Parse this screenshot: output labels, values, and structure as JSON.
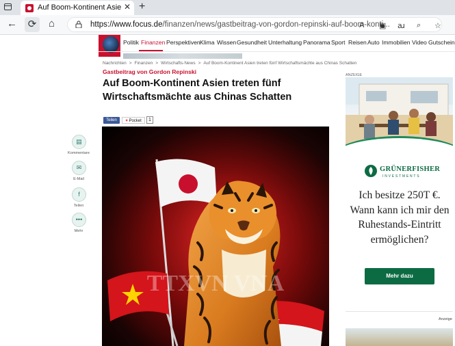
{
  "browser": {
    "tab_title": "Auf Boom-Kontinent Asien treten",
    "tab_close": "✕",
    "new_tab": "+",
    "url_domain": "https://www.focus.de",
    "url_path": "/finanzen/news/gastbeitrag-von-gordon-repinski-auf-boom-konti...",
    "icons": {
      "back": "←",
      "reload": "⟳",
      "home": "⌂",
      "lock": "🔒",
      "read_aloud": "A",
      "immersive": "▣",
      "translate": "ꜷ",
      "zoom": "⌕",
      "favorites": "☆"
    }
  },
  "site": {
    "menu": [
      {
        "label": "Politik",
        "active": false
      },
      {
        "label": "Finanzen",
        "active": true
      },
      {
        "label": "Perspektiven",
        "active": false
      },
      {
        "label": "Klima",
        "active": false
      },
      {
        "label": "Wissen",
        "active": false
      },
      {
        "label": "Gesundheit",
        "active": false
      },
      {
        "label": "Unterhaltung",
        "active": false
      },
      {
        "label": "Panorama",
        "active": false
      },
      {
        "label": "Sport",
        "active": false
      },
      {
        "label": "Reisen",
        "active": false
      },
      {
        "label": "Auto",
        "active": false
      },
      {
        "label": "Immobilien",
        "active": false
      },
      {
        "label": "Video",
        "active": false
      },
      {
        "label": "Gutscheine",
        "active": false
      }
    ],
    "accent_color": "#c8102e"
  },
  "article": {
    "breadcrumb": [
      "Nachrichten",
      "Finanzen",
      "Wirtschafts-News",
      "Auf Boom-Kontinent Asien treten fünf Wirtschaftsmächte aus Chinas Schatten"
    ],
    "breadcrumb_sep": ">",
    "kicker": "Gastbeitrag von Gordon Repinski",
    "headline": "Auf Boom-Kontinent Asien treten fünf Wirtschaftsmächte aus Chinas Schatten",
    "share": {
      "teilen": "Teilen",
      "pocket": "Pocket",
      "count": "1"
    },
    "hero_watermark": "TTXVN VNA"
  },
  "side_actions": [
    {
      "icon": "comment-icon",
      "glyph": "▤",
      "label": "Kommentare"
    },
    {
      "icon": "mail-icon",
      "glyph": "✉",
      "label": "E-Mail"
    },
    {
      "icon": "facebook-icon",
      "glyph": "f",
      "label": "Teilen"
    },
    {
      "icon": "more-icon",
      "glyph": "•••",
      "label": "Mehr"
    }
  ],
  "ad": {
    "label": "ANZEIGE",
    "brand_name": "GRÜNERFISHER",
    "brand_sub": "INVESTMENTS",
    "copy": "Ich besitze 250T €. Wann kann ich mir den Ruhestands-Eintritt ermöglichen?",
    "cta": "Mehr dazu",
    "brand_color": "#0d6b43",
    "second_label": "Anzeige"
  }
}
